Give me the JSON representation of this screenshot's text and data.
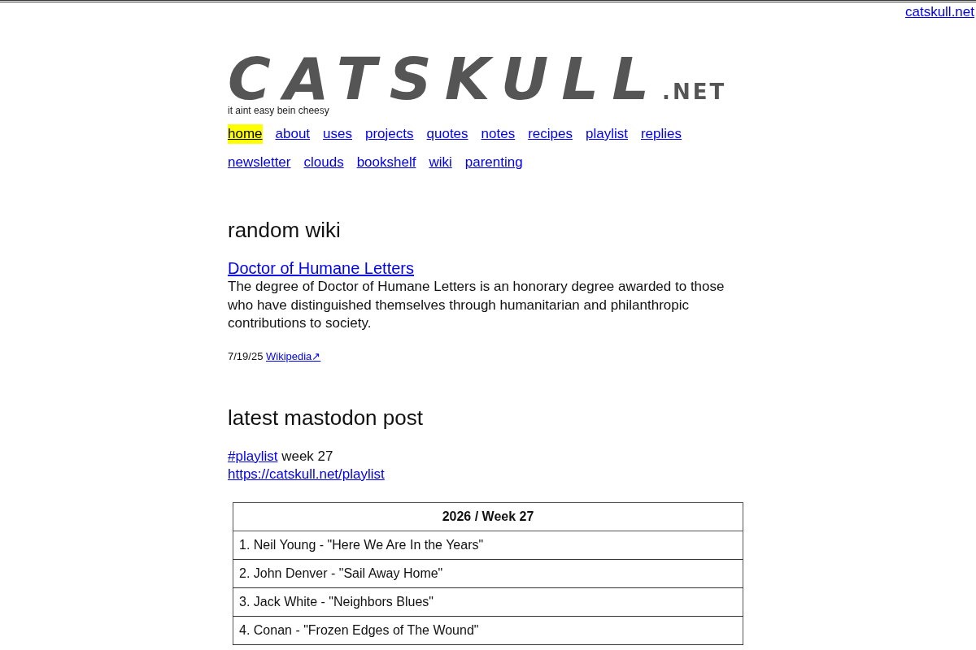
{
  "top_link": "catskull.net",
  "logo": {
    "name": "CATSKULL",
    "suffix": ".NET",
    "tagline": "it aint easy bein cheesy"
  },
  "nav": [
    {
      "label": "home",
      "selected": true
    },
    {
      "label": "about",
      "selected": false
    },
    {
      "label": "uses",
      "selected": false
    },
    {
      "label": "projects",
      "selected": false
    },
    {
      "label": "quotes",
      "selected": false
    },
    {
      "label": "notes",
      "selected": false
    },
    {
      "label": "recipes",
      "selected": false
    },
    {
      "label": "playlist",
      "selected": false
    },
    {
      "label": "replies",
      "selected": false
    },
    {
      "label": "newsletter",
      "selected": false
    },
    {
      "label": "clouds",
      "selected": false
    },
    {
      "label": "bookshelf",
      "selected": false
    },
    {
      "label": "wiki",
      "selected": false
    },
    {
      "label": "parenting",
      "selected": false
    }
  ],
  "random_wiki": {
    "heading": "random wiki",
    "title": "Doctor of Humane Letters",
    "summary": "The degree of Doctor of Humane Letters is an honorary degree awarded to those who have distinguished themselves through humanitarian and philanthropic contributions to society.",
    "date": "7/19/25",
    "source_link": "Wikipedia↗"
  },
  "mastodon": {
    "heading": "latest mastodon post",
    "hashtag": "#playlist",
    "text": "week 27",
    "url": "https://catskull.net/playlist",
    "table": {
      "header": "2026 / Week 27",
      "rows": [
        "1. Neil Young - \"Here We Are In the Years\"",
        "2. John Denver - \"Sail Away Home\"",
        "3. Jack White - \"Neighbors Blues\"",
        "4. Conan - \"Frozen Edges of The Wound\""
      ]
    }
  }
}
